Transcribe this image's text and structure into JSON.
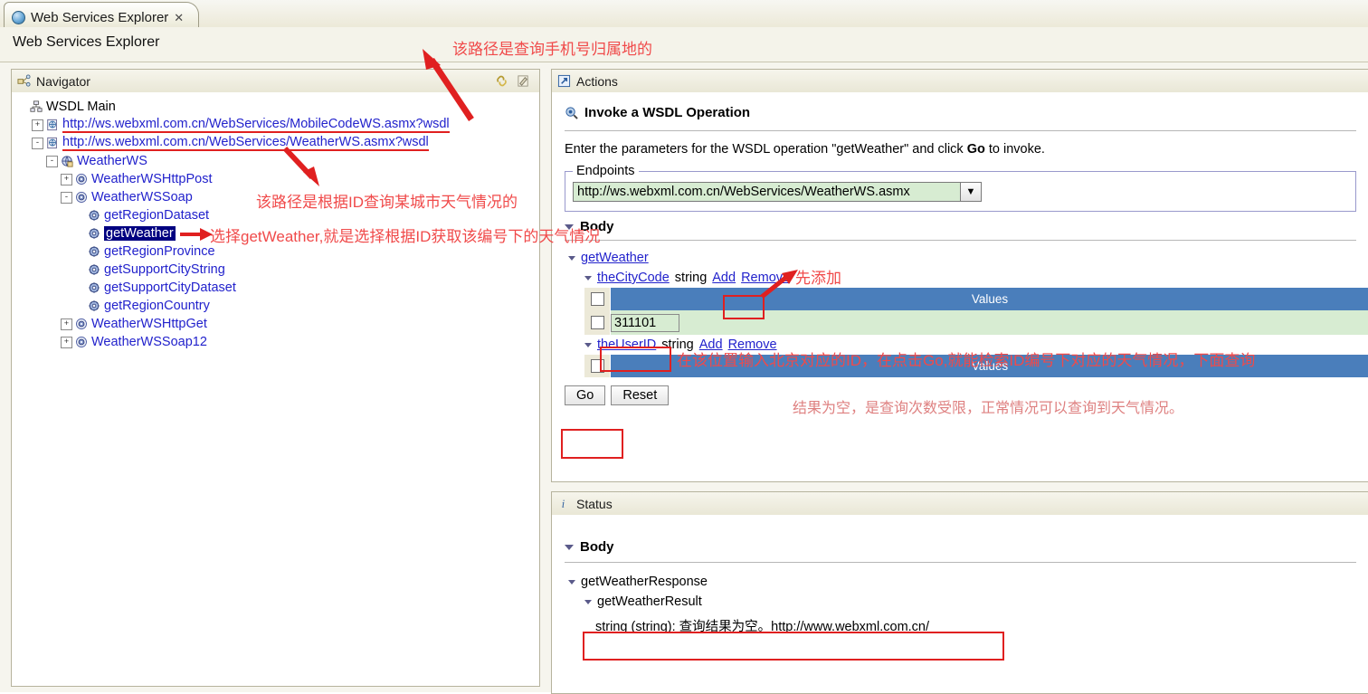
{
  "window": {
    "tab_title": "Web Services Explorer",
    "tab_close": "✕",
    "page_title": "Web Services Explorer"
  },
  "navigator": {
    "header": "Navigator",
    "tools": [
      "link-icon",
      "pencil-icon"
    ],
    "tree": [
      {
        "id": "wsdl-main",
        "label": "WSDL Main",
        "icon": "wsdl-main-icon",
        "indent": 0,
        "expander": "",
        "color": "plain"
      },
      {
        "id": "mobilecode-wsdl",
        "label": "http://ws.webxml.com.cn/WebServices/MobileCodeWS.asmx?wsdl",
        "icon": "wsdl-doc-icon",
        "indent": 1,
        "expander": "+",
        "underline": true
      },
      {
        "id": "weather-wsdl",
        "label": "http://ws.webxml.com.cn/WebServices/WeatherWS.asmx?wsdl",
        "icon": "wsdl-doc-icon",
        "indent": 1,
        "expander": "-",
        "underline": true
      },
      {
        "id": "weatherws",
        "label": "WeatherWS",
        "icon": "service-icon",
        "indent": 2,
        "expander": "-"
      },
      {
        "id": "weatherws-httppost",
        "label": "WeatherWSHttpPost",
        "icon": "port-icon",
        "indent": 3,
        "expander": "+"
      },
      {
        "id": "weatherws-soap",
        "label": "WeatherWSSoap",
        "icon": "port-icon",
        "indent": 3,
        "expander": "-"
      },
      {
        "id": "op-getregiondataset",
        "label": "getRegionDataset",
        "icon": "operation-icon",
        "indent": 4,
        "expander": ""
      },
      {
        "id": "op-getweather",
        "label": "getWeather",
        "icon": "operation-icon",
        "indent": 4,
        "expander": "",
        "selected": true
      },
      {
        "id": "op-getregionprovince",
        "label": "getRegionProvince",
        "icon": "operation-icon",
        "indent": 4,
        "expander": ""
      },
      {
        "id": "op-getsupportcitystring",
        "label": "getSupportCityString",
        "icon": "operation-icon",
        "indent": 4,
        "expander": ""
      },
      {
        "id": "op-getsupportcitydataset",
        "label": "getSupportCityDataset",
        "icon": "operation-icon",
        "indent": 4,
        "expander": ""
      },
      {
        "id": "op-getregioncountry",
        "label": "getRegionCountry",
        "icon": "operation-icon",
        "indent": 4,
        "expander": ""
      },
      {
        "id": "weatherws-httpget",
        "label": "WeatherWSHttpGet",
        "icon": "port-icon",
        "indent": 3,
        "expander": "+"
      },
      {
        "id": "weatherws-soap12",
        "label": "WeatherWSSoap12",
        "icon": "port-icon",
        "indent": 3,
        "expander": "+"
      }
    ]
  },
  "actions": {
    "header": "Actions",
    "invoke_title": "Invoke a WSDL Operation",
    "instruction_pre": "Enter the parameters for the WSDL operation \"getWeather\" and click ",
    "instruction_bold": "Go",
    "instruction_post": " to invoke.",
    "endpoints_legend": "Endpoints",
    "endpoint_value": "http://ws.webxml.com.cn/WebServices/WeatherWS.asmx",
    "body_label": "Body",
    "operation": "getWeather",
    "params": [
      {
        "name": "theCityCode",
        "type": "string",
        "add": "Add",
        "remove": "Remove",
        "values_header": "Values",
        "value": "311101",
        "has_input": true
      },
      {
        "name": "theUserID",
        "type": "string",
        "add": "Add",
        "remove": "Remove",
        "values_header": "Values",
        "value": "",
        "has_input": false
      }
    ],
    "go_button": "Go",
    "reset_button": "Reset"
  },
  "status": {
    "header": "Status",
    "body_label": "Body",
    "response_node": "getWeatherResponse",
    "result_node": "getWeatherResult",
    "result_value": "string (string): 查询结果为空。http://www.webxml.com.cn/"
  },
  "annotations": [
    {
      "id": "anno-mobilecode-path",
      "text": "该路径是查询手机号归属地的"
    },
    {
      "id": "anno-weather-path",
      "text": "该路径是根据ID查询某城市天气情况的"
    },
    {
      "id": "anno-select-getweather",
      "text": "选择getWeather,就是选择根据ID获取该编号下的天气情况"
    },
    {
      "id": "anno-add-first",
      "text": "先添加"
    },
    {
      "id": "anno-input-id",
      "text": "在该位置输入北京对应的ID，在点击Go,就能检索ID编号下对应的天气情况，下面查询"
    },
    {
      "id": "anno-empty-result",
      "text": "结果为空，是查询次数受限，正常情况可以查询到天气情况。"
    }
  ],
  "colors": {
    "accent_blue": "#2222cc",
    "annotation_red": "#f04a4a",
    "highlight_box": "#e02020",
    "row_blue": "#4a7ebb",
    "input_green": "#d7ecd2",
    "selection_navy": "#000080"
  }
}
